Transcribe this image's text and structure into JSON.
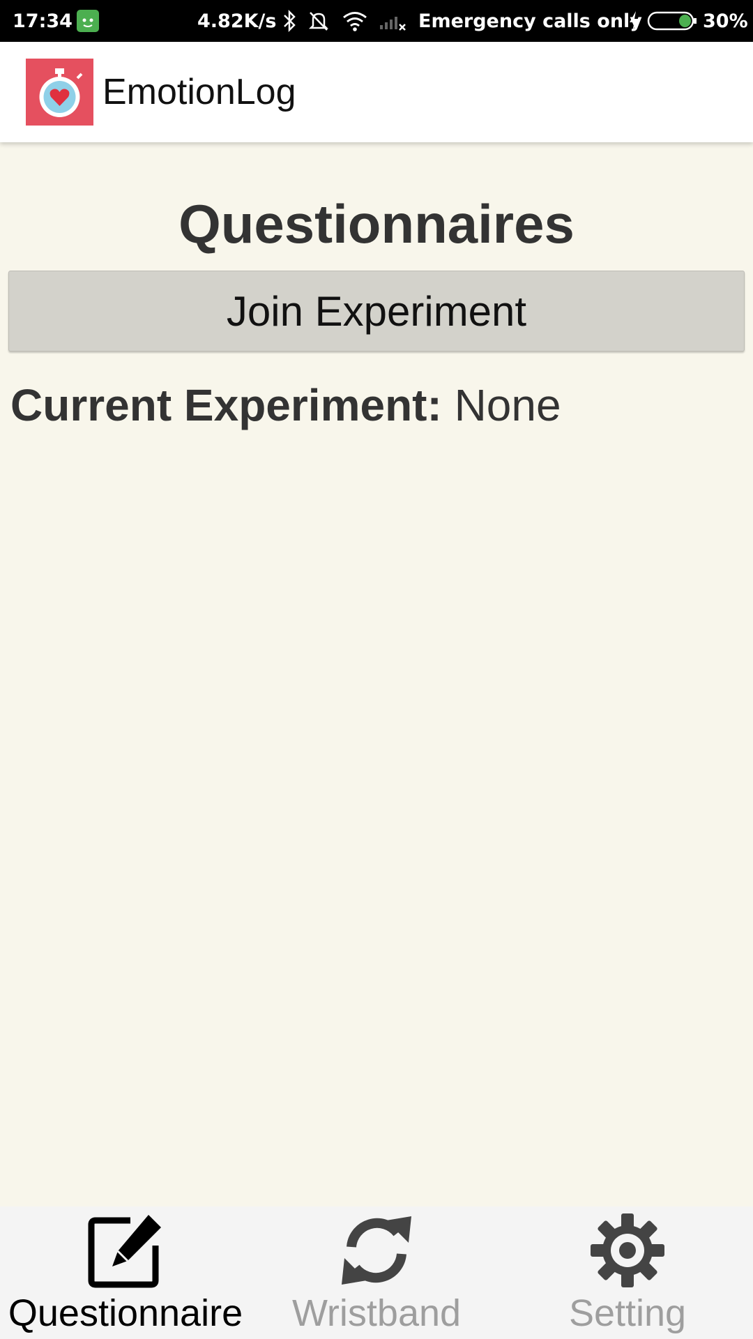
{
  "status_bar": {
    "time": "17:34",
    "net_speed": "4.82K/s",
    "carrier": "Emergency calls only",
    "battery_percent": "30%",
    "battery_level": 0.3
  },
  "app_bar": {
    "title": "EmotionLog",
    "logo_icon": "stopwatch-heart-icon"
  },
  "main": {
    "heading": "Questionnaires",
    "join_button_label": "Join Experiment",
    "current_experiment_label": "Current Experiment:",
    "current_experiment_value": "None"
  },
  "bottom_nav": {
    "items": [
      {
        "label": "Questionnaire",
        "icon": "edit-icon",
        "active": true
      },
      {
        "label": "Wristband",
        "icon": "sync-icon",
        "active": false
      },
      {
        "label": "Setting",
        "icon": "gear-icon",
        "active": false
      }
    ]
  },
  "colors": {
    "background": "#f8f6eb",
    "logo_bg": "#e5505f",
    "button_bg": "#d3d2cb",
    "nav_active": "#000000",
    "nav_inactive": "#9e9e9e"
  }
}
